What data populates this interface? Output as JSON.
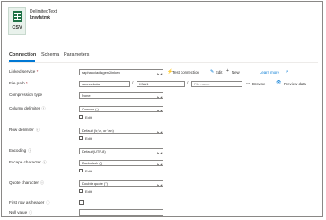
{
  "header": {
    "title": "DelimitedText",
    "subtitle": "knwfstmk",
    "tile_label": "CSV",
    "tile_color": "#1e7145"
  },
  "tabs": [
    {
      "label": "Connection",
      "active": true
    },
    {
      "label": "Schema",
      "active": false
    },
    {
      "label": "Parameters",
      "active": false
    }
  ],
  "linked_service": {
    "label": "Linked service",
    "required_mark": "*",
    "value": "saphaociadlsgen2linkeu",
    "test_connection": "Test connection",
    "edit": "Edit",
    "new": "New",
    "learn_more": "Learn more"
  },
  "file_path": {
    "label": "File path",
    "required_mark": "*",
    "container": "sourcedata",
    "separator": "/",
    "directory": "KNA1",
    "file_placeholder": "File name",
    "browse": "Browse",
    "preview": "Preview data"
  },
  "compression_type": {
    "label": "Compression type",
    "value": "None"
  },
  "column_delimiter": {
    "label": "Column delimiter",
    "value": "Comma (,)",
    "edit": "Edit"
  },
  "row_delimiter": {
    "label": "Row delimiter",
    "value": "Default (\\r,\\n, or \\r\\n)",
    "edit": "Edit"
  },
  "encoding": {
    "label": "Encoding",
    "value": "Default(UTF-8)"
  },
  "escape_character": {
    "label": "Escape character",
    "value": "Backslash (\\)",
    "edit": "Edit"
  },
  "quote_character": {
    "label": "Quote character",
    "value": "Double quote (\")",
    "edit": "Edit"
  },
  "first_row_header": {
    "label": "First row as header",
    "checked": false
  },
  "null_value": {
    "label": "Null value",
    "value": ""
  },
  "colors": {
    "accent": "#0078d4",
    "required": "#a4262c",
    "border": "#8a8886"
  }
}
